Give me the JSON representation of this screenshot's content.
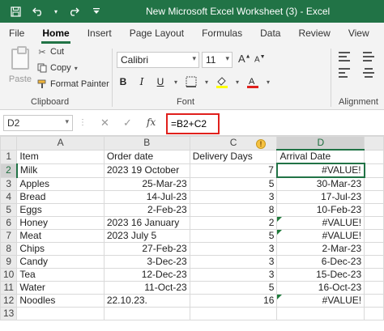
{
  "window": {
    "title": "New Microsoft Excel Worksheet (3)  -  Excel"
  },
  "quick_access": {
    "save_icon": "save-icon",
    "undo_icon": "undo-icon",
    "redo_icon": "redo-icon",
    "customize_icon": "customize-icon"
  },
  "tabs": [
    {
      "label": "File"
    },
    {
      "label": "Home"
    },
    {
      "label": "Insert"
    },
    {
      "label": "Page Layout"
    },
    {
      "label": "Formulas"
    },
    {
      "label": "Data"
    },
    {
      "label": "Review"
    },
    {
      "label": "View"
    }
  ],
  "ribbon": {
    "clipboard": {
      "paste_label": "Paste",
      "cut_label": "Cut",
      "copy_label": "Copy",
      "format_painter_label": "Format Painter",
      "group_label": "Clipboard"
    },
    "font": {
      "font_name": "Calibri",
      "font_size": "11",
      "bold": "B",
      "italic": "I",
      "underline": "U",
      "grow": "A",
      "shrink": "A",
      "group_label": "Font"
    },
    "alignment": {
      "group_label": "Alignment"
    }
  },
  "formula_bar": {
    "name_box": "D2",
    "fx": "fx",
    "cancel": "✕",
    "enter": "✓",
    "formula": "=B2+C2"
  },
  "grid": {
    "columns": [
      "A",
      "B",
      "C",
      "D"
    ],
    "rows": [
      {
        "n": "1",
        "a": "Item",
        "b": "Order date",
        "c": "Delivery Days",
        "d": "Arrival Date"
      },
      {
        "n": "2",
        "a": "Milk",
        "b": "2023 19 October",
        "c": "7",
        "d": "#VALUE!"
      },
      {
        "n": "3",
        "a": "Apples",
        "b": "25-Mar-23",
        "c": "5",
        "d": "30-Mar-23"
      },
      {
        "n": "4",
        "a": "Bread",
        "b": "14-Jul-23",
        "c": "3",
        "d": "17-Jul-23"
      },
      {
        "n": "5",
        "a": "Eggs",
        "b": "2-Feb-23",
        "c": "8",
        "d": "10-Feb-23"
      },
      {
        "n": "6",
        "a": "Honey",
        "b": "2023 16 January",
        "c": "2",
        "d": "#VALUE!"
      },
      {
        "n": "7",
        "a": "Meat",
        "b": "2023 July 5",
        "c": "5",
        "d": "#VALUE!"
      },
      {
        "n": "8",
        "a": "Chips",
        "b": "27-Feb-23",
        "c": "3",
        "d": "2-Mar-23"
      },
      {
        "n": "9",
        "a": "Candy",
        "b": "3-Dec-23",
        "c": "3",
        "d": "6-Dec-23"
      },
      {
        "n": "10",
        "a": "Tea",
        "b": "12-Dec-23",
        "c": "3",
        "d": "15-Dec-23"
      },
      {
        "n": "11",
        "a": "Water",
        "b": "11-Oct-23",
        "c": "5",
        "d": "16-Oct-23"
      },
      {
        "n": "12",
        "a": "Noodles",
        "b": "22.10.23.",
        "c": "16",
        "d": "#VALUE!"
      },
      {
        "n": "13",
        "a": "",
        "b": "",
        "c": "",
        "d": ""
      }
    ]
  },
  "colors": {
    "accent": "#217346",
    "highlight_border": "#e0201c",
    "warning": "#f6c242"
  }
}
